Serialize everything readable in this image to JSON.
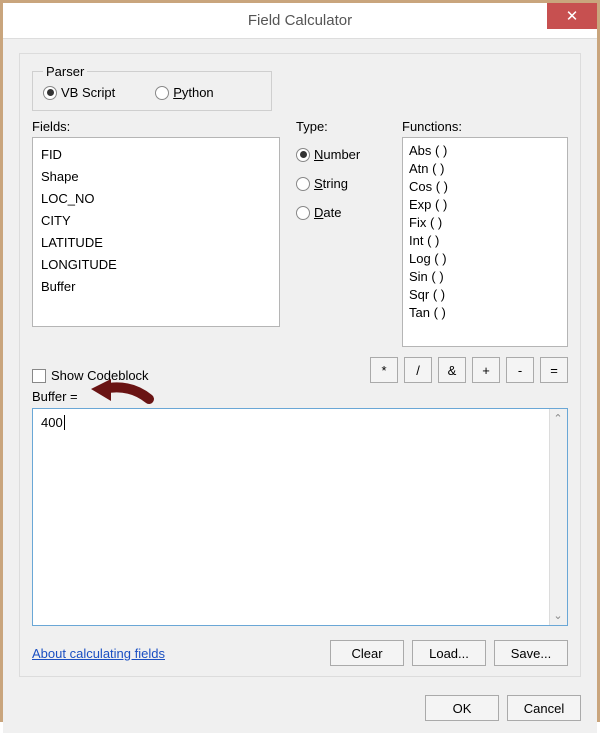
{
  "window": {
    "title": "Field Calculator",
    "close_glyph": "✕"
  },
  "parser": {
    "legend": "Parser",
    "vb_label": "VB Script",
    "python_label_pre": "P",
    "python_label_rest": "ython",
    "selected": "vb"
  },
  "fields": {
    "label": "Fields:",
    "items": [
      "FID",
      "Shape",
      "LOC_NO",
      "CITY",
      "LATITUDE",
      "LONGITUDE",
      "Buffer"
    ]
  },
  "type": {
    "label": "Type:",
    "number_pre": "N",
    "number_rest": "umber",
    "string_pre": "S",
    "string_rest": "tring",
    "date_pre": "D",
    "date_rest": "ate",
    "selected": "number"
  },
  "functions": {
    "label": "Functions:",
    "items": [
      "Abs ( )",
      "Atn ( )",
      "Cos ( )",
      "Exp ( )",
      "Fix ( )",
      "Int ( )",
      "Log ( )",
      "Sin ( )",
      "Sqr ( )",
      "Tan ( )"
    ]
  },
  "operators": {
    "mul": "*",
    "div": "/",
    "amp": "&",
    "plus": "+",
    "minus": "-",
    "eq": "="
  },
  "codeblock": {
    "label": "Show Codeblock",
    "checked": false
  },
  "expression": {
    "label": "Buffer =",
    "value": "400"
  },
  "link": {
    "about": "About calculating fields"
  },
  "buttons": {
    "clear": "Clear",
    "load": "Load...",
    "save": "Save...",
    "ok": "OK",
    "cancel": "Cancel"
  }
}
